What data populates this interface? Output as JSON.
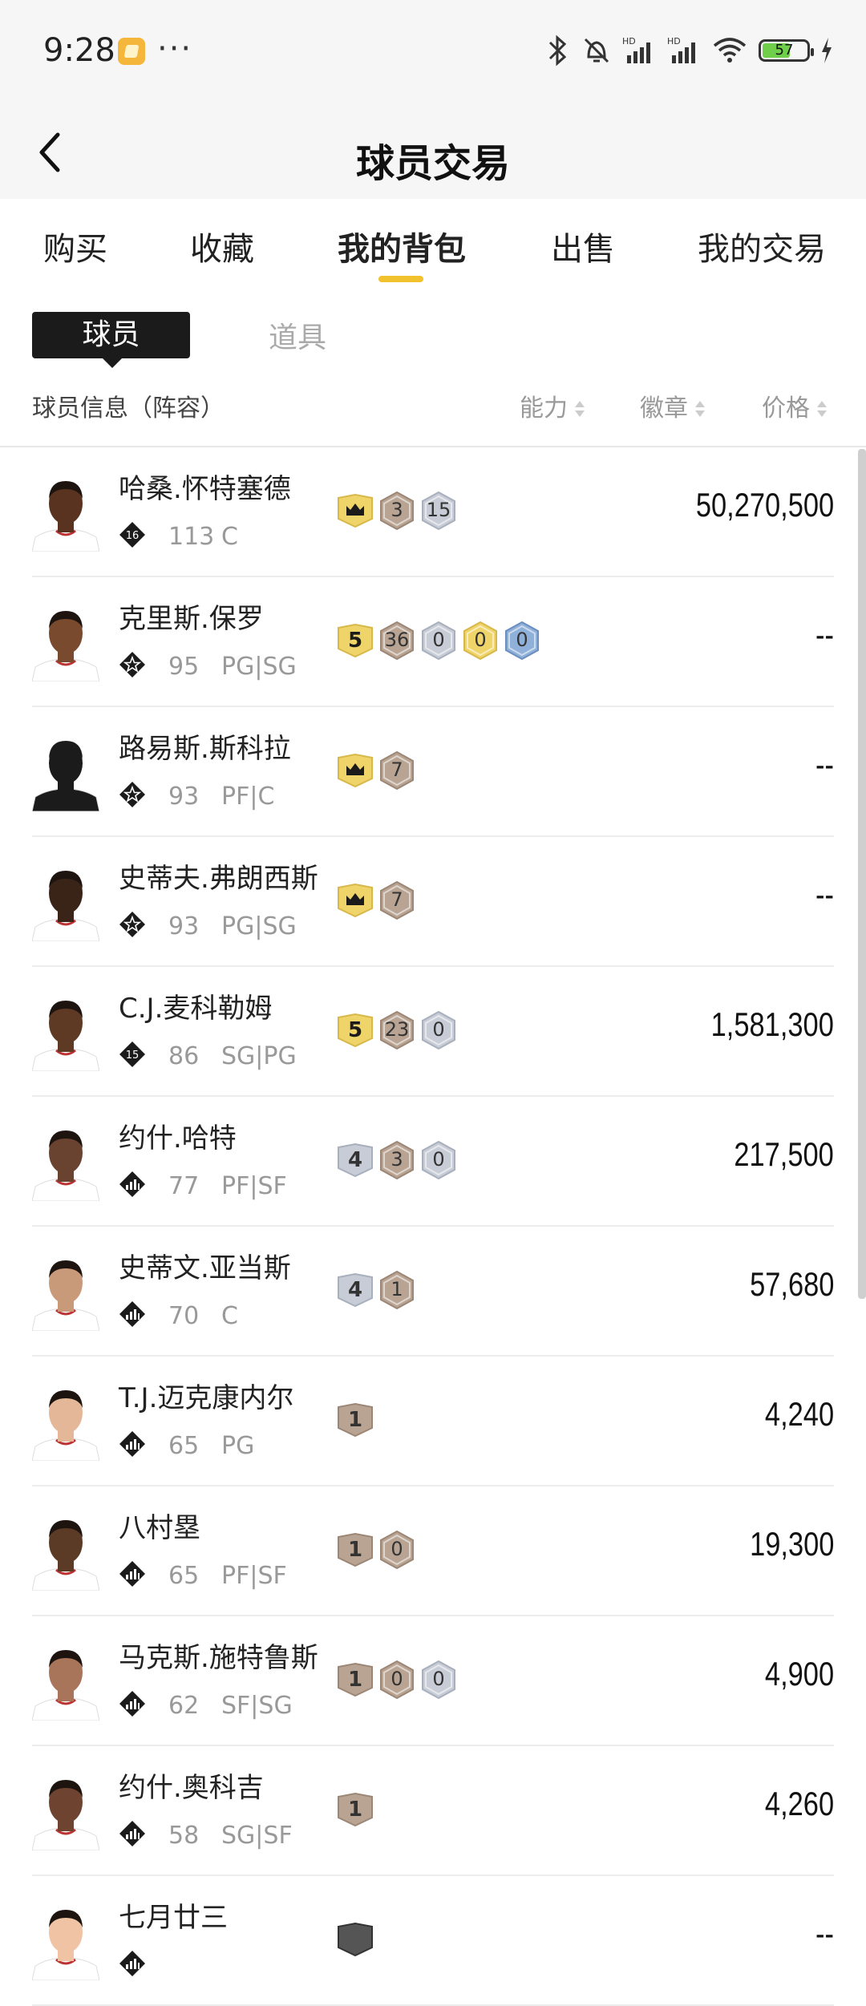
{
  "status_bar": {
    "time": "9:28",
    "battery": "57",
    "more": "···"
  },
  "header": {
    "title": "球员交易"
  },
  "tabs": [
    {
      "label": "购买"
    },
    {
      "label": "收藏"
    },
    {
      "label": "我的背包",
      "active": true
    },
    {
      "label": "出售"
    },
    {
      "label": "我的交易"
    }
  ],
  "subtabs": {
    "player": "球员",
    "item": "道具"
  },
  "columns": {
    "info": "球员信息（阵容）",
    "ability": "能力",
    "badge": "徽章",
    "price": "价格"
  },
  "players": [
    {
      "name": "哈桑.怀特塞德",
      "tier": "16",
      "rating": "113",
      "pos": "C",
      "price": "50,270,500",
      "badges": [
        {
          "t": "shield",
          "c": "gold",
          "v": "crown"
        },
        {
          "t": "hex",
          "c": "bronze",
          "v": "3"
        },
        {
          "t": "hex",
          "c": "silver",
          "v": "15"
        }
      ]
    },
    {
      "name": "克里斯.保罗",
      "tier": "star",
      "rating": "95",
      "pos": "PG|SG",
      "price": "--",
      "badges": [
        {
          "t": "shield",
          "c": "gold",
          "v": "5"
        },
        {
          "t": "hex",
          "c": "bronze",
          "v": "36"
        },
        {
          "t": "hex",
          "c": "silver",
          "v": "0"
        },
        {
          "t": "hex",
          "c": "gold",
          "v": "0"
        },
        {
          "t": "hex",
          "c": "blue",
          "v": "0"
        }
      ]
    },
    {
      "name": "路易斯.斯科拉",
      "tier": "star",
      "rating": "93",
      "pos": "PF|C",
      "price": "--",
      "badges": [
        {
          "t": "shield",
          "c": "gold",
          "v": "crown"
        },
        {
          "t": "hex",
          "c": "bronze",
          "v": "7"
        }
      ]
    },
    {
      "name": "史蒂夫.弗朗西斯",
      "tier": "star",
      "rating": "93",
      "pos": "PG|SG",
      "price": "--",
      "badges": [
        {
          "t": "shield",
          "c": "gold",
          "v": "crown"
        },
        {
          "t": "hex",
          "c": "bronze",
          "v": "7"
        }
      ]
    },
    {
      "name": "C.J.麦科勒姆",
      "tier": "15",
      "rating": "86",
      "pos": "SG|PG",
      "price": "1,581,300",
      "badges": [
        {
          "t": "shield",
          "c": "gold",
          "v": "5"
        },
        {
          "t": "hex",
          "c": "bronze",
          "v": "23"
        },
        {
          "t": "hex",
          "c": "silver",
          "v": "0"
        }
      ]
    },
    {
      "name": "约什.哈特",
      "tier": "bars",
      "rating": "77",
      "pos": "PF|SF",
      "price": "217,500",
      "badges": [
        {
          "t": "shield",
          "c": "silver",
          "v": "4"
        },
        {
          "t": "hex",
          "c": "bronze",
          "v": "3"
        },
        {
          "t": "hex",
          "c": "silver",
          "v": "0"
        }
      ]
    },
    {
      "name": "史蒂文.亚当斯",
      "tier": "bars",
      "rating": "70",
      "pos": "C",
      "price": "57,680",
      "badges": [
        {
          "t": "shield",
          "c": "silver",
          "v": "4"
        },
        {
          "t": "hex",
          "c": "bronze",
          "v": "1"
        }
      ]
    },
    {
      "name": "T.J.迈克康内尔",
      "tier": "bars",
      "rating": "65",
      "pos": "PG",
      "price": "4,240",
      "badges": [
        {
          "t": "shield",
          "c": "bronze",
          "v": "1"
        }
      ]
    },
    {
      "name": "八村塁",
      "tier": "bars",
      "rating": "65",
      "pos": "PF|SF",
      "price": "19,300",
      "badges": [
        {
          "t": "shield",
          "c": "bronze",
          "v": "1"
        },
        {
          "t": "hex",
          "c": "bronze",
          "v": "0"
        }
      ]
    },
    {
      "name": "马克斯.施特鲁斯",
      "tier": "bars",
      "rating": "62",
      "pos": "SF|SG",
      "price": "4,900",
      "badges": [
        {
          "t": "shield",
          "c": "bronze",
          "v": "1"
        },
        {
          "t": "hex",
          "c": "bronze",
          "v": "0"
        },
        {
          "t": "hex",
          "c": "silver",
          "v": "0"
        }
      ]
    },
    {
      "name": "约什.奥科吉",
      "tier": "bars",
      "rating": "58",
      "pos": "SG|SF",
      "price": "4,260",
      "badges": [
        {
          "t": "shield",
          "c": "bronze",
          "v": "1"
        }
      ]
    },
    {
      "name": "七月廿三",
      "tier": "bars",
      "rating": "",
      "pos": "",
      "price": "--",
      "badges": [
        {
          "t": "shield",
          "c": "dark",
          "v": ""
        }
      ]
    }
  ],
  "colors": {
    "accent": "#f2c12e",
    "gold": "#efd46a",
    "silver": "#c7ccd6",
    "bronze": "#b9a493",
    "blue": "#8fb0d8"
  }
}
